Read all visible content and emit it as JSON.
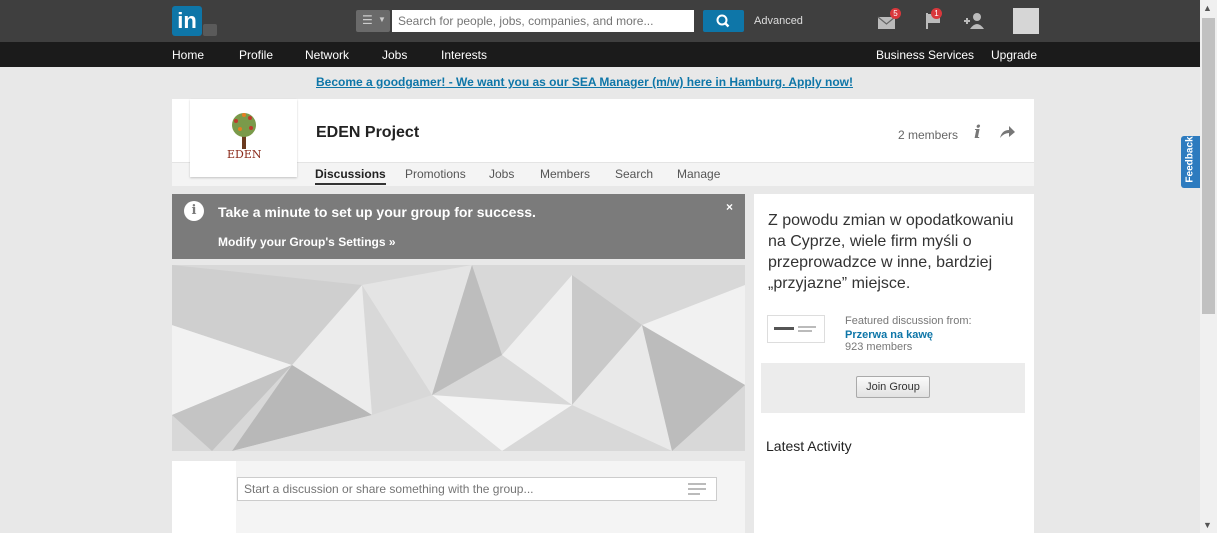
{
  "topbar": {
    "logo_text": "in",
    "search_placeholder": "Search for people, jobs, companies, and more...",
    "advanced_label": "Advanced",
    "messages_badge": "5",
    "notifications_badge": "1",
    "colors": {
      "bar": "#3f3f3f",
      "brand": "#0e76a8",
      "badge": "#d9383c"
    }
  },
  "nav": {
    "items": [
      "Home",
      "Profile",
      "Network",
      "Jobs",
      "Interests"
    ],
    "business_services": "Business Services",
    "upgrade": "Upgrade"
  },
  "ad": {
    "link_text": "Become a goodgamer!",
    "rest_text": " - We want you as our SEA Manager (m/w) here in Hamburg. Apply now!"
  },
  "group": {
    "logo_text": "EDEN",
    "name": "EDEN Project",
    "members": "2 members",
    "tabs": [
      "Discussions",
      "Promotions",
      "Jobs",
      "Members",
      "Search",
      "Manage"
    ]
  },
  "notice": {
    "title": "Take a minute to set up your group for success.",
    "link": "Modify your Group's Settings »",
    "close": "×"
  },
  "composer": {
    "placeholder": "Start a discussion or share something with the group..."
  },
  "sidebar": {
    "featured_text": "Z powodu zmian w opodatkowaniu na Cyprze, wiele firm myśli o przeprowadzce w inne, bardziej „przyjazne” miejsce.",
    "featured_label": "Featured discussion from:",
    "featured_group": "Przerwa na kawę",
    "featured_members": "923 members",
    "join_button": "Join Group",
    "latest_activity": "Latest Activity"
  },
  "feedback_label": "Feedback"
}
